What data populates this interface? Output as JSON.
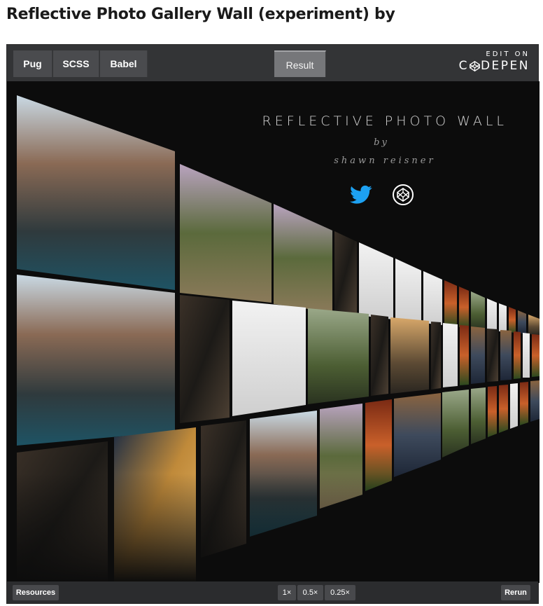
{
  "page": {
    "title": "Reflective Photo Gallery Wall (experiment) by"
  },
  "editor": {
    "tabs": {
      "pug": "Pug",
      "scss": "SCSS",
      "babel": "Babel",
      "result": "Result"
    },
    "edit_on": {
      "line1": "EDIT ON",
      "brand_c": "C",
      "brand_rest": "DEPEN"
    }
  },
  "result": {
    "title": "REFLECTIVE PHOTO WALL",
    "by": "by",
    "author": "shawn reisner",
    "icons": [
      "twitter-icon",
      "codepen-icon"
    ],
    "colors": {
      "twitter": "#1da1f2",
      "background": "#0c0c0c"
    }
  },
  "footer": {
    "resources": "Resources",
    "zoom_1": "1×",
    "zoom_05": "0.5×",
    "zoom_025": "0.25×",
    "rerun": "Rerun"
  }
}
